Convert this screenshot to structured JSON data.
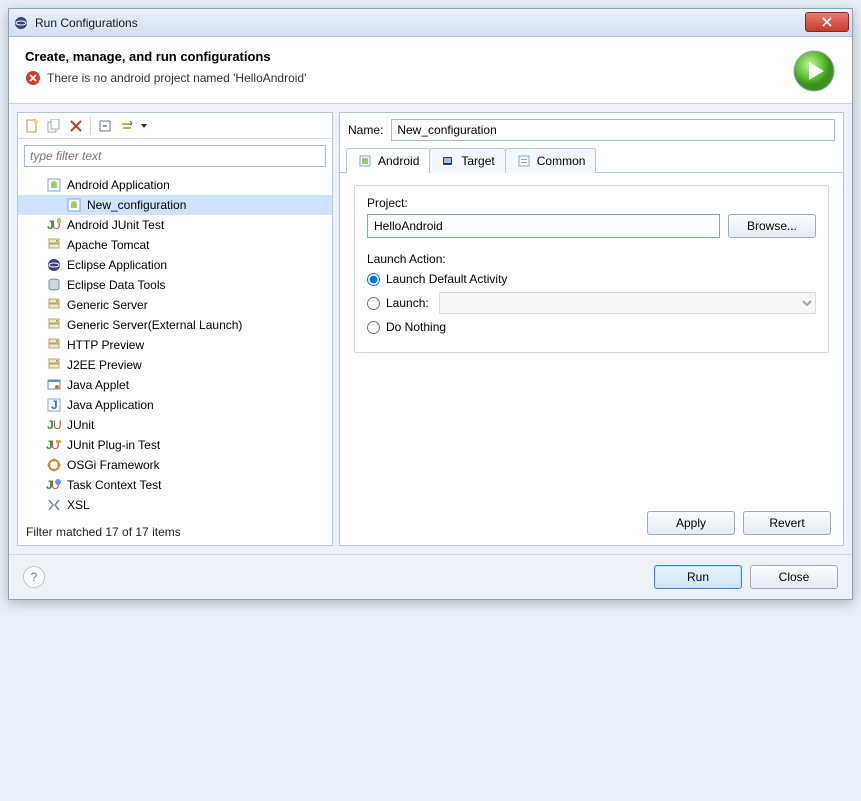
{
  "window": {
    "title": "Run Configurations"
  },
  "header": {
    "title": "Create, manage, and run configurations",
    "error": "There is no android project named 'HelloAndroid'"
  },
  "filter": {
    "placeholder": "type filter text"
  },
  "tree": {
    "items": [
      {
        "label": "Android Application",
        "icon": "android"
      },
      {
        "label": "New_configuration",
        "icon": "android",
        "child": true,
        "selected": true
      },
      {
        "label": "Android JUnit Test",
        "icon": "junit-android"
      },
      {
        "label": "Apache Tomcat",
        "icon": "server"
      },
      {
        "label": "Eclipse Application",
        "icon": "eclipse"
      },
      {
        "label": "Eclipse Data Tools",
        "icon": "database"
      },
      {
        "label": "Generic Server",
        "icon": "server"
      },
      {
        "label": "Generic Server(External Launch)",
        "icon": "server"
      },
      {
        "label": "HTTP Preview",
        "icon": "server"
      },
      {
        "label": "J2EE Preview",
        "icon": "server"
      },
      {
        "label": "Java Applet",
        "icon": "applet"
      },
      {
        "label": "Java Application",
        "icon": "java-app"
      },
      {
        "label": "JUnit",
        "icon": "junit"
      },
      {
        "label": "JUnit Plug-in Test",
        "icon": "junit-plugin"
      },
      {
        "label": "OSGi Framework",
        "icon": "osgi"
      },
      {
        "label": "Task Context Test",
        "icon": "task"
      },
      {
        "label": "XSL",
        "icon": "xsl"
      }
    ],
    "status": "Filter matched 17 of 17 items"
  },
  "form": {
    "name_label": "Name:",
    "name_value": "New_configuration",
    "tabs": {
      "android": "Android",
      "target": "Target",
      "common": "Common"
    },
    "project_label": "Project:",
    "project_value": "HelloAndroid",
    "browse": "Browse...",
    "launch_action_label": "Launch Action:",
    "opt_default": "Launch Default Activity",
    "opt_launch": "Launch:",
    "opt_nothing": "Do Nothing",
    "apply": "Apply",
    "revert": "Revert"
  },
  "footer": {
    "run": "Run",
    "close": "Close"
  }
}
